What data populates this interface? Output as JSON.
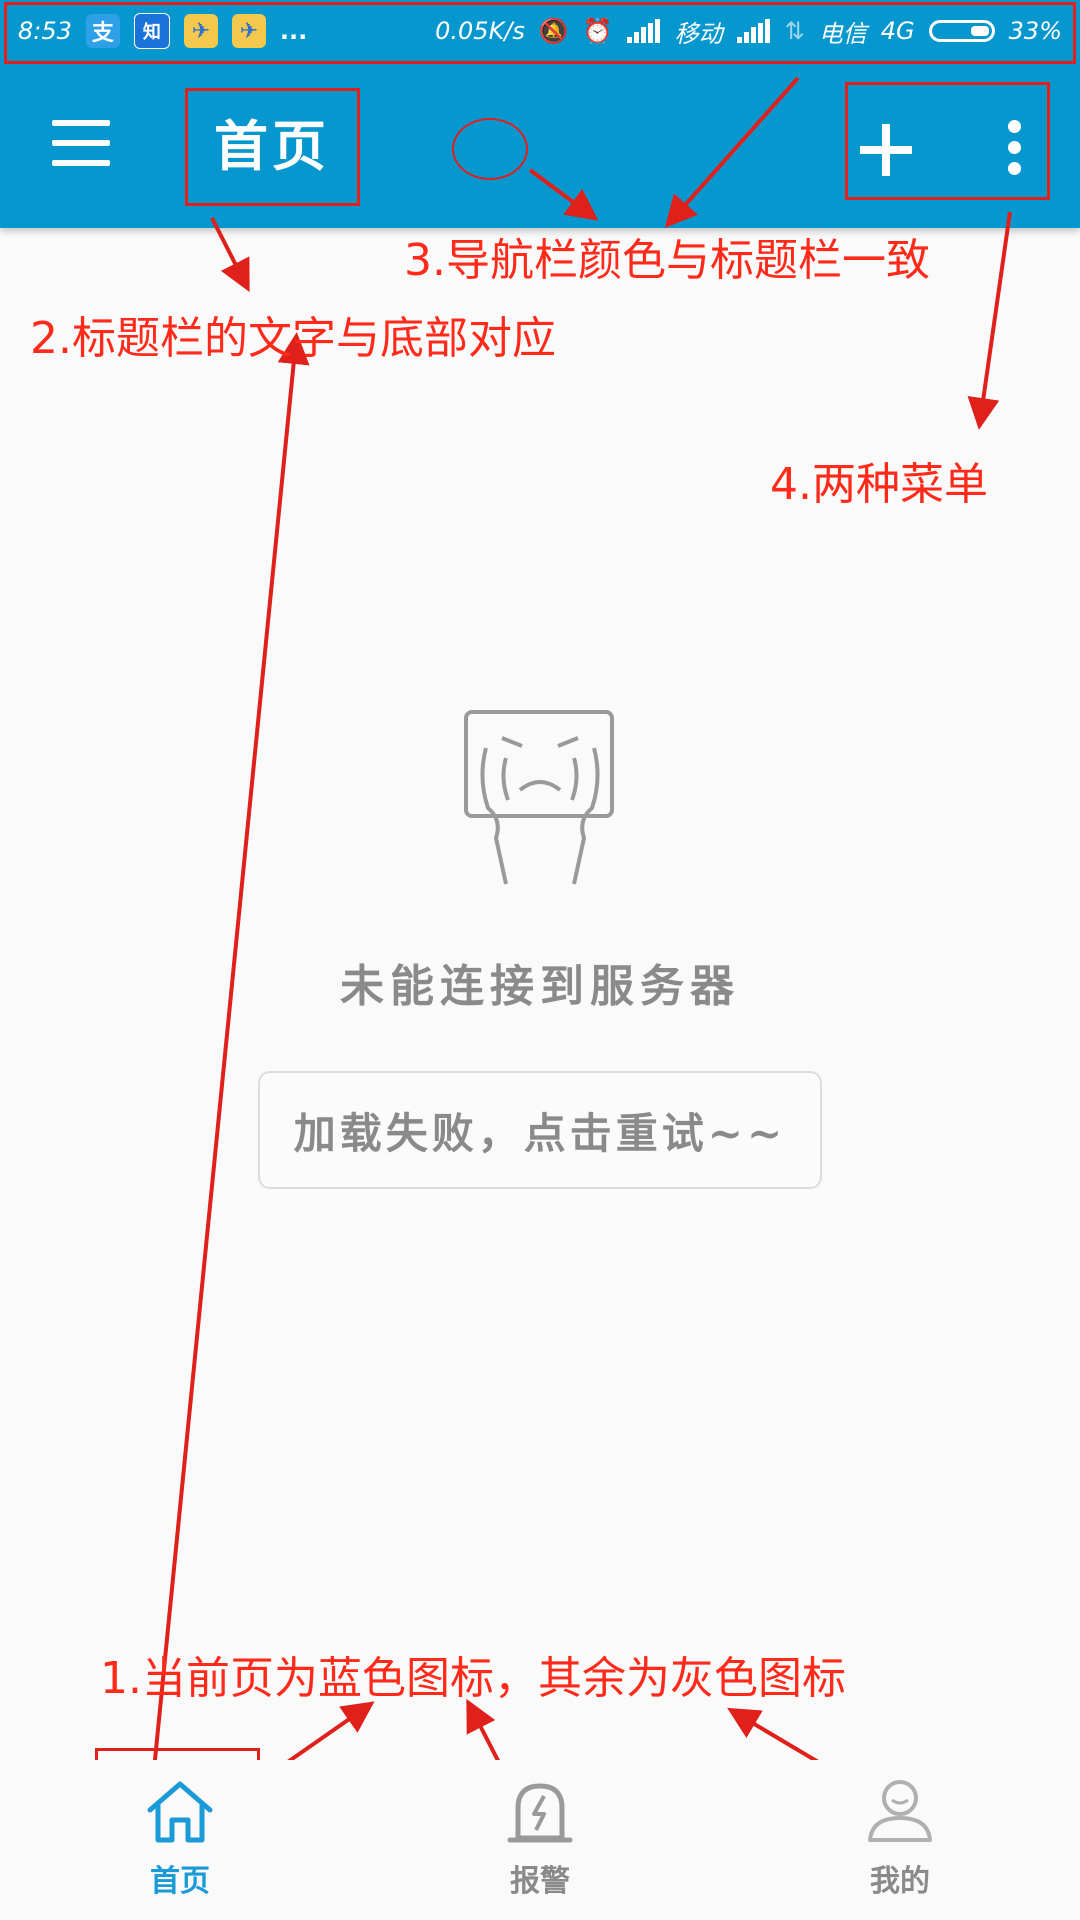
{
  "status_bar": {
    "time": "8:53",
    "apps": [
      {
        "name": "alipay-icon",
        "glyph": "支"
      },
      {
        "name": "zhihu-icon",
        "glyph": "知"
      },
      {
        "name": "plane-app-icon",
        "glyph": "✈"
      },
      {
        "name": "plane-app-icon",
        "glyph": "✈"
      }
    ],
    "more": "...",
    "speed": "0.05K/s",
    "carrier1": "移动",
    "carrier2": "电信",
    "network": "4G",
    "battery": "33%"
  },
  "app_bar": {
    "title": "首页",
    "color": "#0797cf"
  },
  "annotations": {
    "a1": "1.当前页为蓝色图标，其余为灰色图标",
    "a2": "2.标题栏的文字与底部对应",
    "a3": "3.导航栏颜色与标题栏一致",
    "a4": "4.两种菜单"
  },
  "empty_state": {
    "message": "未能连接到服务器",
    "retry_label": "加载失败，点击重试~~"
  },
  "bottom_nav": {
    "active_color": "#1a9ad6",
    "inactive_color": "#9a9a9a",
    "items": [
      {
        "label": "首页",
        "icon": "home-icon",
        "active": true
      },
      {
        "label": "报警",
        "icon": "alarm-icon",
        "active": false
      },
      {
        "label": "我的",
        "icon": "profile-icon",
        "active": false
      }
    ]
  }
}
